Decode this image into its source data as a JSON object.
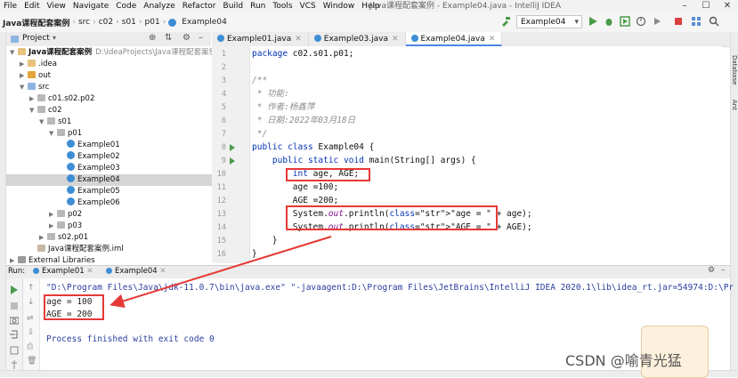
{
  "menubar": {
    "items": [
      "File",
      "Edit",
      "View",
      "Navigate",
      "Code",
      "Analyze",
      "Refactor",
      "Build",
      "Run",
      "Tools",
      "VCS",
      "Window",
      "Help"
    ],
    "title": "Java课程配套案例 - Example04.java - IntelliJ IDEA"
  },
  "navbar": {
    "crumbs": [
      "Java课程配套案例",
      "src",
      "c02",
      "s01",
      "p01",
      "Example04"
    ],
    "run_config": "Example04"
  },
  "project": {
    "title": "Project",
    "tree": [
      {
        "depth": 0,
        "arrow": "▼",
        "icon": "folder",
        "label": "Java课程配套案例",
        "extra": "D:\\IdeaProjects\\Java课程配套案例"
      },
      {
        "depth": 1,
        "arrow": "▶",
        "icon": "folder",
        "label": ".idea",
        "extra": ""
      },
      {
        "depth": 1,
        "arrow": "▶",
        "icon": "folder orange",
        "label": "out",
        "extra": ""
      },
      {
        "depth": 1,
        "arrow": "▼",
        "icon": "folder blue",
        "label": "src",
        "extra": ""
      },
      {
        "depth": 2,
        "arrow": "▶",
        "icon": "folder gray",
        "label": "c01.s02.p02",
        "extra": ""
      },
      {
        "depth": 2,
        "arrow": "▼",
        "icon": "folder gray",
        "label": "c02",
        "extra": ""
      },
      {
        "depth": 3,
        "arrow": "▼",
        "icon": "folder gray",
        "label": "s01",
        "extra": ""
      },
      {
        "depth": 4,
        "arrow": "▼",
        "icon": "folder gray",
        "label": "p01",
        "extra": ""
      },
      {
        "depth": 5,
        "arrow": "",
        "icon": "class",
        "label": "Example01",
        "extra": ""
      },
      {
        "depth": 5,
        "arrow": "",
        "icon": "class",
        "label": "Example02",
        "extra": ""
      },
      {
        "depth": 5,
        "arrow": "",
        "icon": "class",
        "label": "Example03",
        "extra": ""
      },
      {
        "depth": 5,
        "arrow": "",
        "icon": "class",
        "label": "Example04",
        "extra": "",
        "selected": true
      },
      {
        "depth": 5,
        "arrow": "",
        "icon": "class",
        "label": "Example05",
        "extra": ""
      },
      {
        "depth": 5,
        "arrow": "",
        "icon": "class",
        "label": "Example06",
        "extra": ""
      },
      {
        "depth": 4,
        "arrow": "▶",
        "icon": "folder gray",
        "label": "p02",
        "extra": ""
      },
      {
        "depth": 4,
        "arrow": "▶",
        "icon": "folder gray",
        "label": "p03",
        "extra": ""
      },
      {
        "depth": 3,
        "arrow": "▶",
        "icon": "folder gray",
        "label": "s02.p01",
        "extra": ""
      },
      {
        "depth": 2,
        "arrow": "",
        "icon": "file",
        "label": "Java课程配套案例.iml",
        "extra": ""
      },
      {
        "depth": 0,
        "arrow": "▶",
        "icon": "lib",
        "label": "External Libraries",
        "extra": ""
      }
    ]
  },
  "editor": {
    "tabs": [
      {
        "label": "Example01.java",
        "active": false
      },
      {
        "label": "Example03.java",
        "active": false
      },
      {
        "label": "Example04.java",
        "active": true
      }
    ],
    "line_numbers": [
      "1",
      "2",
      "3",
      "4",
      "5",
      "6",
      "7",
      "8",
      "9",
      "10",
      "11",
      "12",
      "13",
      "14",
      "15",
      "16"
    ],
    "lines": [
      "package c02.s01.p01;",
      "",
      "/**",
      " * 功能:",
      " * 作者:杨鑫萍",
      " * 日期:2022年03月18日",
      " */",
      "public class Example04 {",
      "    public static void main(String[] args) {",
      "        int age, AGE;",
      "        age =100;",
      "        AGE =200;",
      "        System.out.println(\"age = \" + age);",
      "        System.out.println(\"AGE = \" + AGE);",
      "    }",
      "}"
    ]
  },
  "run": {
    "label": "Run:",
    "tabs": [
      "Example01",
      "Example04"
    ],
    "command": "\"D:\\Program Files\\Java\\jdk-11.0.7\\bin\\java.exe\" \"-javaagent:D:\\Program Files\\JetBrains\\IntelliJ IDEA 2020.1\\lib\\idea_rt.jar=54974:D:\\Pr",
    "output": [
      "age = 100",
      "AGE = 200"
    ],
    "exit": "Process finished with exit code 0"
  },
  "right_strip": {
    "items": [
      "Database",
      "Ant"
    ]
  },
  "watermark": "CSDN @喻青光猛",
  "colors": {
    "annotation_red": "#e53935",
    "keyword": "#0033b3",
    "string": "#067d17",
    "comment": "#8c8c8c",
    "field": "#871094"
  }
}
